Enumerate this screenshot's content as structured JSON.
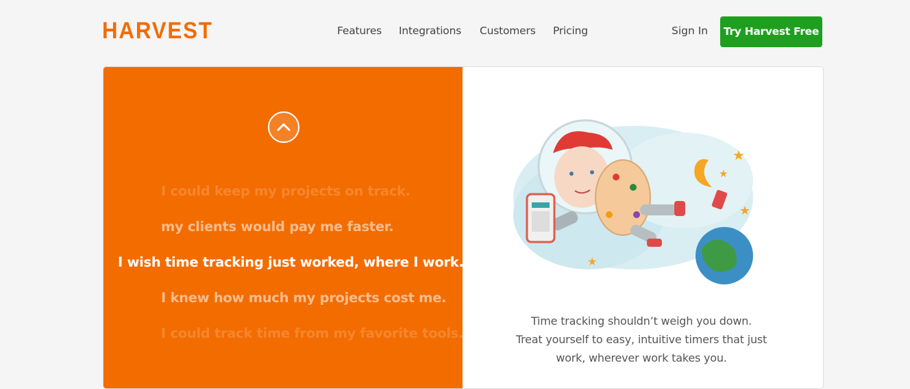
{
  "brand": {
    "name": "HARVEST",
    "color": "#f36c00"
  },
  "nav": {
    "items": [
      {
        "label": "Features"
      },
      {
        "label": "Integrations"
      },
      {
        "label": "Customers"
      },
      {
        "label": "Pricing"
      }
    ],
    "sign_in": "Sign In",
    "cta": "Try Harvest Free"
  },
  "hero": {
    "scroll_up_icon": "chevron-up-icon",
    "phrases": [
      "I could keep my projects on track.",
      "my clients would pay me faster.",
      "I wish time tracking just worked, where I work.",
      "I knew how much my projects cost me.",
      "I could track time from my favorite tools."
    ],
    "description_lines": [
      "Time tracking shouldn’t weigh you down.",
      "Treat yourself to easy, intuitive timers that just",
      "work, wherever work takes you."
    ]
  },
  "colors": {
    "accent": "#f36c00",
    "cta": "#1f9f1f"
  }
}
